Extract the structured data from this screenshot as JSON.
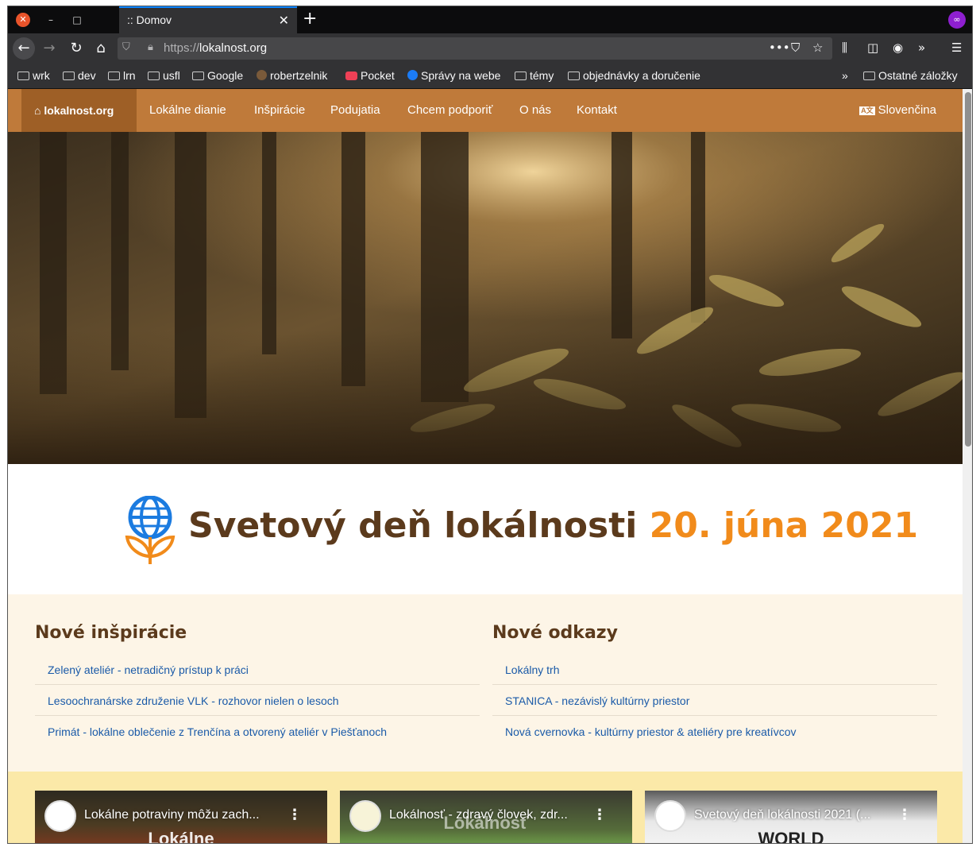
{
  "browser": {
    "tab_title": ":: Domov",
    "url_prefix": "https://",
    "url_domain": "lokalnost.org",
    "bookmarks": [
      "wrk",
      "dev",
      "lrn",
      "usfl",
      "Google",
      "robertzelnik",
      "Pocket",
      "Správy na webe",
      "témy",
      "objednávky a doručenie"
    ],
    "other_bookmarks": "Ostatné záložky"
  },
  "site": {
    "brand": "lokalnost.org",
    "nav": [
      "Lokálne dianie",
      "Inšpirácie",
      "Podujatia",
      "Chcem podporiť",
      "O nás",
      "Kontakt"
    ],
    "language": "Slovenčina",
    "headline": "Svetový deň lokálnosti",
    "headline_date": "20. júna 2021",
    "inspirations": {
      "heading": "Nové inšpirácie",
      "items": [
        "Zelený ateliér - netradičný prístup k práci",
        "Lesoochranárske združenie VLK - rozhovor nielen o lesoch",
        "Primát - lokálne oblečenie z Trenčína a otvorený ateliér v Piešťanoch"
      ]
    },
    "links": {
      "heading": "Nové odkazy",
      "items": [
        "Lokálny trh",
        "STANICA - nezávislý kultúrny priestor",
        "Nová cvernovka - kultúrny priestor & ateliéry pre kreatívcov"
      ]
    },
    "videos": [
      {
        "title": "Lokálne potraviny môžu zach...",
        "overlay": "Lokálne"
      },
      {
        "title": "Lokálnosť - zdravý človek, zdr...",
        "overlay": "Lokálnosť"
      },
      {
        "title": "Svetový deň lokálnosti 2021 (...",
        "overlay": "WORLD"
      }
    ]
  },
  "colors": {
    "nav_bg": "#bf7a3a",
    "brand_bg": "#9e5f26",
    "headline_brown": "#5b3a1c",
    "headline_orange": "#f18b1b",
    "news_bg": "#fdf5e7",
    "videos_bg": "#fbe9a8",
    "link_blue": "#1a5aa8"
  }
}
